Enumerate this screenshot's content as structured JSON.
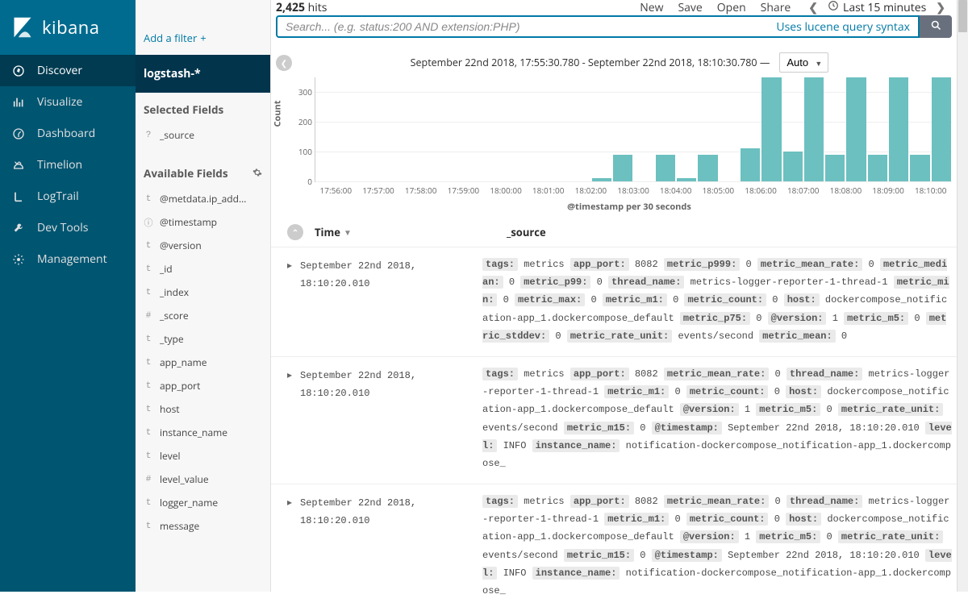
{
  "brand": "kibana",
  "nav": [
    {
      "id": "discover",
      "label": "Discover"
    },
    {
      "id": "visualize",
      "label": "Visualize"
    },
    {
      "id": "dashboard",
      "label": "Dashboard"
    },
    {
      "id": "timelion",
      "label": "Timelion"
    },
    {
      "id": "logtrail",
      "label": "LogTrail"
    },
    {
      "id": "devtools",
      "label": "Dev Tools"
    },
    {
      "id": "management",
      "label": "Management"
    }
  ],
  "add_filter_label": "Add a filter",
  "index_pattern": "logstash-*",
  "selected_fields_title": "Selected Fields",
  "selected_fields": [
    {
      "type": "?",
      "name": "_source"
    }
  ],
  "available_fields_title": "Available Fields",
  "available_fields": [
    {
      "type": "t",
      "name": "@metdata.ip_add..."
    },
    {
      "type": "ⓘ",
      "name": "@timestamp"
    },
    {
      "type": "t",
      "name": "@version"
    },
    {
      "type": "t",
      "name": "_id"
    },
    {
      "type": "t",
      "name": "_index"
    },
    {
      "type": "#",
      "name": "_score"
    },
    {
      "type": "t",
      "name": "_type"
    },
    {
      "type": "t",
      "name": "app_name"
    },
    {
      "type": "t",
      "name": "app_port"
    },
    {
      "type": "t",
      "name": "host"
    },
    {
      "type": "t",
      "name": "instance_name"
    },
    {
      "type": "t",
      "name": "level"
    },
    {
      "type": "#",
      "name": "level_value"
    },
    {
      "type": "t",
      "name": "logger_name"
    },
    {
      "type": "t",
      "name": "message"
    }
  ],
  "hits_count": "2,425",
  "hits_label": "hits",
  "top_links": {
    "new": "New",
    "save": "Save",
    "open": "Open",
    "share": "Share"
  },
  "time_range_label": "Last 15 minutes",
  "search_placeholder": "Search... (e.g. status:200 AND extension:PHP)",
  "lucene_hint": "Uses lucene query syntax",
  "histogram_range": "September 22nd 2018, 17:55:30.780 - September 22nd 2018, 18:10:30.780 —",
  "interval_value": "Auto",
  "chart_data": {
    "type": "bar",
    "title": "",
    "ylabel": "Count",
    "xlabel": "@timestamp per 30 seconds",
    "ylim": [
      0,
      350
    ],
    "y_ticks": [
      0,
      100,
      200,
      300
    ],
    "categories": [
      "17:56:00",
      "17:57:00",
      "17:58:00",
      "17:59:00",
      "18:00:00",
      "18:01:00",
      "18:02:00",
      "18:03:00",
      "18:04:00",
      "18:05:00",
      "18:06:00",
      "18:07:00",
      "18:08:00",
      "18:09:00",
      "18:10:00"
    ],
    "values": [
      0,
      0,
      0,
      0,
      0,
      0,
      0,
      0,
      0,
      0,
      0,
      0,
      0,
      10,
      90,
      0,
      90,
      10,
      90,
      0,
      110,
      350,
      100,
      350,
      90,
      350,
      90,
      350,
      90,
      350
    ]
  },
  "table": {
    "col_time": "Time",
    "col_source": "_source",
    "rows": [
      {
        "time": "September 22nd 2018, 18:10:20.010",
        "kvs": [
          {
            "k": "tags:",
            "v": "metrics"
          },
          {
            "k": "app_port:",
            "v": "8082"
          },
          {
            "k": "metric_p999:",
            "v": "0"
          },
          {
            "k": "metric_mean_rate:",
            "v": "0"
          },
          {
            "k": "metric_median:",
            "v": "0"
          },
          {
            "k": "metric_p99:",
            "v": "0"
          },
          {
            "k": "thread_name:",
            "v": "metrics-logger-reporter-1-thread-1"
          },
          {
            "k": "metric_min:",
            "v": "0"
          },
          {
            "k": "metric_max:",
            "v": "0"
          },
          {
            "k": "metric_m1:",
            "v": "0"
          },
          {
            "k": "metric_count:",
            "v": "0"
          },
          {
            "k": "host:",
            "v": "dockercompose_notification-app_1.dockercompose_default"
          },
          {
            "k": "metric_p75:",
            "v": "0"
          },
          {
            "k": "@version:",
            "v": "1"
          },
          {
            "k": "metric_m5:",
            "v": "0"
          },
          {
            "k": "metric_stddev:",
            "v": "0"
          },
          {
            "k": "metric_rate_unit:",
            "v": "events/second"
          },
          {
            "k": "metric_mean:",
            "v": "0"
          }
        ]
      },
      {
        "time": "September 22nd 2018, 18:10:20.010",
        "kvs": [
          {
            "k": "tags:",
            "v": "metrics"
          },
          {
            "k": "app_port:",
            "v": "8082"
          },
          {
            "k": "metric_mean_rate:",
            "v": "0"
          },
          {
            "k": "thread_name:",
            "v": "metrics-logger-reporter-1-thread-1"
          },
          {
            "k": "metric_m1:",
            "v": "0"
          },
          {
            "k": "metric_count:",
            "v": "0"
          },
          {
            "k": "host:",
            "v": "dockercompose_notification-app_1.dockercompose_default"
          },
          {
            "k": "@version:",
            "v": "1"
          },
          {
            "k": "metric_m5:",
            "v": "0"
          },
          {
            "k": "metric_rate_unit:",
            "v": "events/second"
          },
          {
            "k": "metric_m15:",
            "v": "0"
          },
          {
            "k": "@timestamp:",
            "v": "September 22nd 2018, 18:10:20.010"
          },
          {
            "k": "level:",
            "v": "INFO"
          },
          {
            "k": "instance_name:",
            "v": "notification-dockercompose_notification-app_1.dockercompose_"
          }
        ]
      },
      {
        "time": "September 22nd 2018, 18:10:20.010",
        "kvs": [
          {
            "k": "tags:",
            "v": "metrics"
          },
          {
            "k": "app_port:",
            "v": "8082"
          },
          {
            "k": "metric_mean_rate:",
            "v": "0"
          },
          {
            "k": "thread_name:",
            "v": "metrics-logger-reporter-1-thread-1"
          },
          {
            "k": "metric_m1:",
            "v": "0"
          },
          {
            "k": "metric_count:",
            "v": "0"
          },
          {
            "k": "host:",
            "v": "dockercompose_notification-app_1.dockercompose_default"
          },
          {
            "k": "@version:",
            "v": "1"
          },
          {
            "k": "metric_m5:",
            "v": "0"
          },
          {
            "k": "metric_rate_unit:",
            "v": "events/second"
          },
          {
            "k": "metric_m15:",
            "v": "0"
          },
          {
            "k": "@timestamp:",
            "v": "September 22nd 2018, 18:10:20.010"
          },
          {
            "k": "level:",
            "v": "INFO"
          },
          {
            "k": "instance_name:",
            "v": "notification-dockercompose_notification-app_1.dockercompose_"
          }
        ]
      }
    ]
  }
}
